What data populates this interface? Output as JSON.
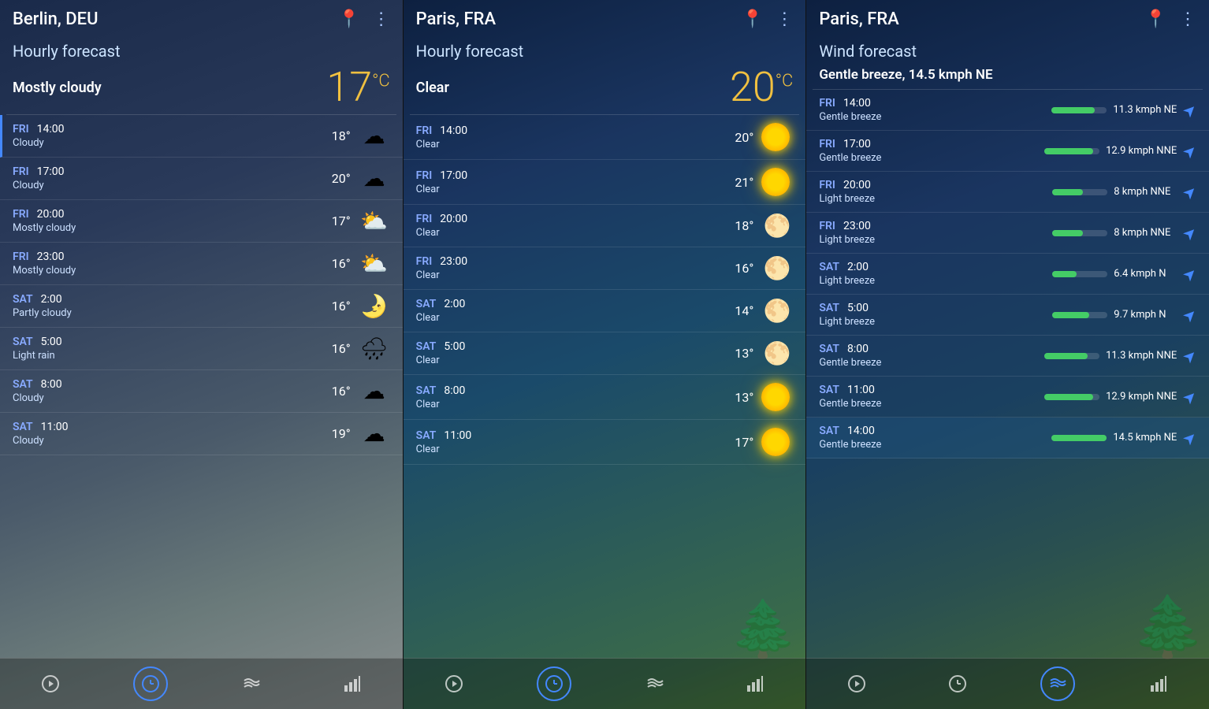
{
  "left": {
    "city": "Berlin, DEU",
    "section": "Hourly forecast",
    "condition": "Mostly cloudy",
    "temp": "17",
    "rows": [
      {
        "day": "FRI",
        "time": "14:00",
        "condition": "Cloudy",
        "temp": "18°",
        "icon": "cloudy",
        "active": true
      },
      {
        "day": "FRI",
        "time": "17:00",
        "condition": "Cloudy",
        "temp": "20°",
        "icon": "cloudy",
        "active": false
      },
      {
        "day": "FRI",
        "time": "20:00",
        "condition": "Mostly cloudy",
        "temp": "17°",
        "icon": "mostly-cloudy",
        "active": false
      },
      {
        "day": "FRI",
        "time": "23:00",
        "condition": "Mostly cloudy",
        "temp": "16°",
        "icon": "mostly-cloudy",
        "active": false
      },
      {
        "day": "SAT",
        "time": "2:00",
        "condition": "Partly cloudy",
        "temp": "16°",
        "icon": "partly-cloudy",
        "active": false
      },
      {
        "day": "SAT",
        "time": "5:00",
        "condition": "Light rain",
        "temp": "16°",
        "icon": "rain",
        "active": false
      },
      {
        "day": "SAT",
        "time": "8:00",
        "condition": "Cloudy",
        "temp": "16°",
        "icon": "cloudy",
        "active": false
      },
      {
        "day": "SAT",
        "time": "11:00",
        "condition": "Cloudy",
        "temp": "19°",
        "icon": "cloudy",
        "active": false
      }
    ],
    "nav": [
      "current",
      "hourly",
      "wind",
      "chart"
    ]
  },
  "middle": {
    "city": "Paris, FRA",
    "section": "Hourly forecast",
    "condition": "Clear",
    "temp": "20",
    "rows": [
      {
        "day": "FRI",
        "time": "14:00",
        "condition": "Clear",
        "temp": "20°",
        "icon": "sun",
        "active": false
      },
      {
        "day": "FRI",
        "time": "17:00",
        "condition": "Clear",
        "temp": "21°",
        "icon": "sun",
        "active": false
      },
      {
        "day": "FRI",
        "time": "20:00",
        "condition": "Clear",
        "temp": "18°",
        "icon": "moon",
        "active": false
      },
      {
        "day": "FRI",
        "time": "23:00",
        "condition": "Clear",
        "temp": "16°",
        "icon": "moon",
        "active": false
      },
      {
        "day": "SAT",
        "time": "2:00",
        "condition": "Clear",
        "temp": "14°",
        "icon": "moon",
        "active": false
      },
      {
        "day": "SAT",
        "time": "5:00",
        "condition": "Clear",
        "temp": "13°",
        "icon": "moon",
        "active": false
      },
      {
        "day": "SAT",
        "time": "8:00",
        "condition": "Clear",
        "temp": "13°",
        "icon": "sun",
        "active": false
      },
      {
        "day": "SAT",
        "time": "11:00",
        "condition": "Clear",
        "temp": "17°",
        "icon": "sun",
        "active": false
      }
    ],
    "nav": [
      "current",
      "hourly",
      "wind",
      "chart"
    ]
  },
  "right": {
    "city": "Paris, FRA",
    "section": "Wind forecast",
    "subtitle": "Gentle breeze, 14.5 kmph NE",
    "rows": [
      {
        "day": "FRI",
        "time": "14:00",
        "type": "Gentle breeze",
        "speed": "11.3 kmph NE",
        "bar": 78,
        "highlighted": false
      },
      {
        "day": "FRI",
        "time": "17:00",
        "type": "Gentle breeze",
        "speed": "12.9 kmph NNE",
        "bar": 89,
        "highlighted": false
      },
      {
        "day": "FRI",
        "time": "20:00",
        "type": "Light breeze",
        "speed": "8 kmph NNE",
        "bar": 55,
        "highlighted": false
      },
      {
        "day": "FRI",
        "time": "23:00",
        "type": "Light breeze",
        "speed": "8 kmph NNE",
        "bar": 55,
        "highlighted": false
      },
      {
        "day": "SAT",
        "time": "2:00",
        "type": "Light breeze",
        "speed": "6.4 kmph N",
        "bar": 44,
        "highlighted": false
      },
      {
        "day": "SAT",
        "time": "5:00",
        "type": "Light breeze",
        "speed": "9.7 kmph N",
        "bar": 67,
        "highlighted": false
      },
      {
        "day": "SAT",
        "time": "8:00",
        "type": "Gentle breeze",
        "speed": "11.3 kmph NNE",
        "bar": 78,
        "highlighted": false
      },
      {
        "day": "SAT",
        "time": "11:00",
        "type": "Gentle breeze",
        "speed": "12.9 kmph NNE",
        "bar": 89,
        "highlighted": false
      },
      {
        "day": "SAT",
        "time": "14:00",
        "type": "Gentle breeze",
        "speed": "14.5 kmph NE",
        "bar": 100,
        "highlighted": true
      }
    ],
    "nav": [
      "current",
      "hourly",
      "wind",
      "chart"
    ]
  },
  "icons": {
    "pin": "📍",
    "dots": "⋮",
    "nav_current": "▶",
    "nav_hourly": "🕐",
    "nav_wind": "🎏",
    "nav_chart": "📊"
  }
}
